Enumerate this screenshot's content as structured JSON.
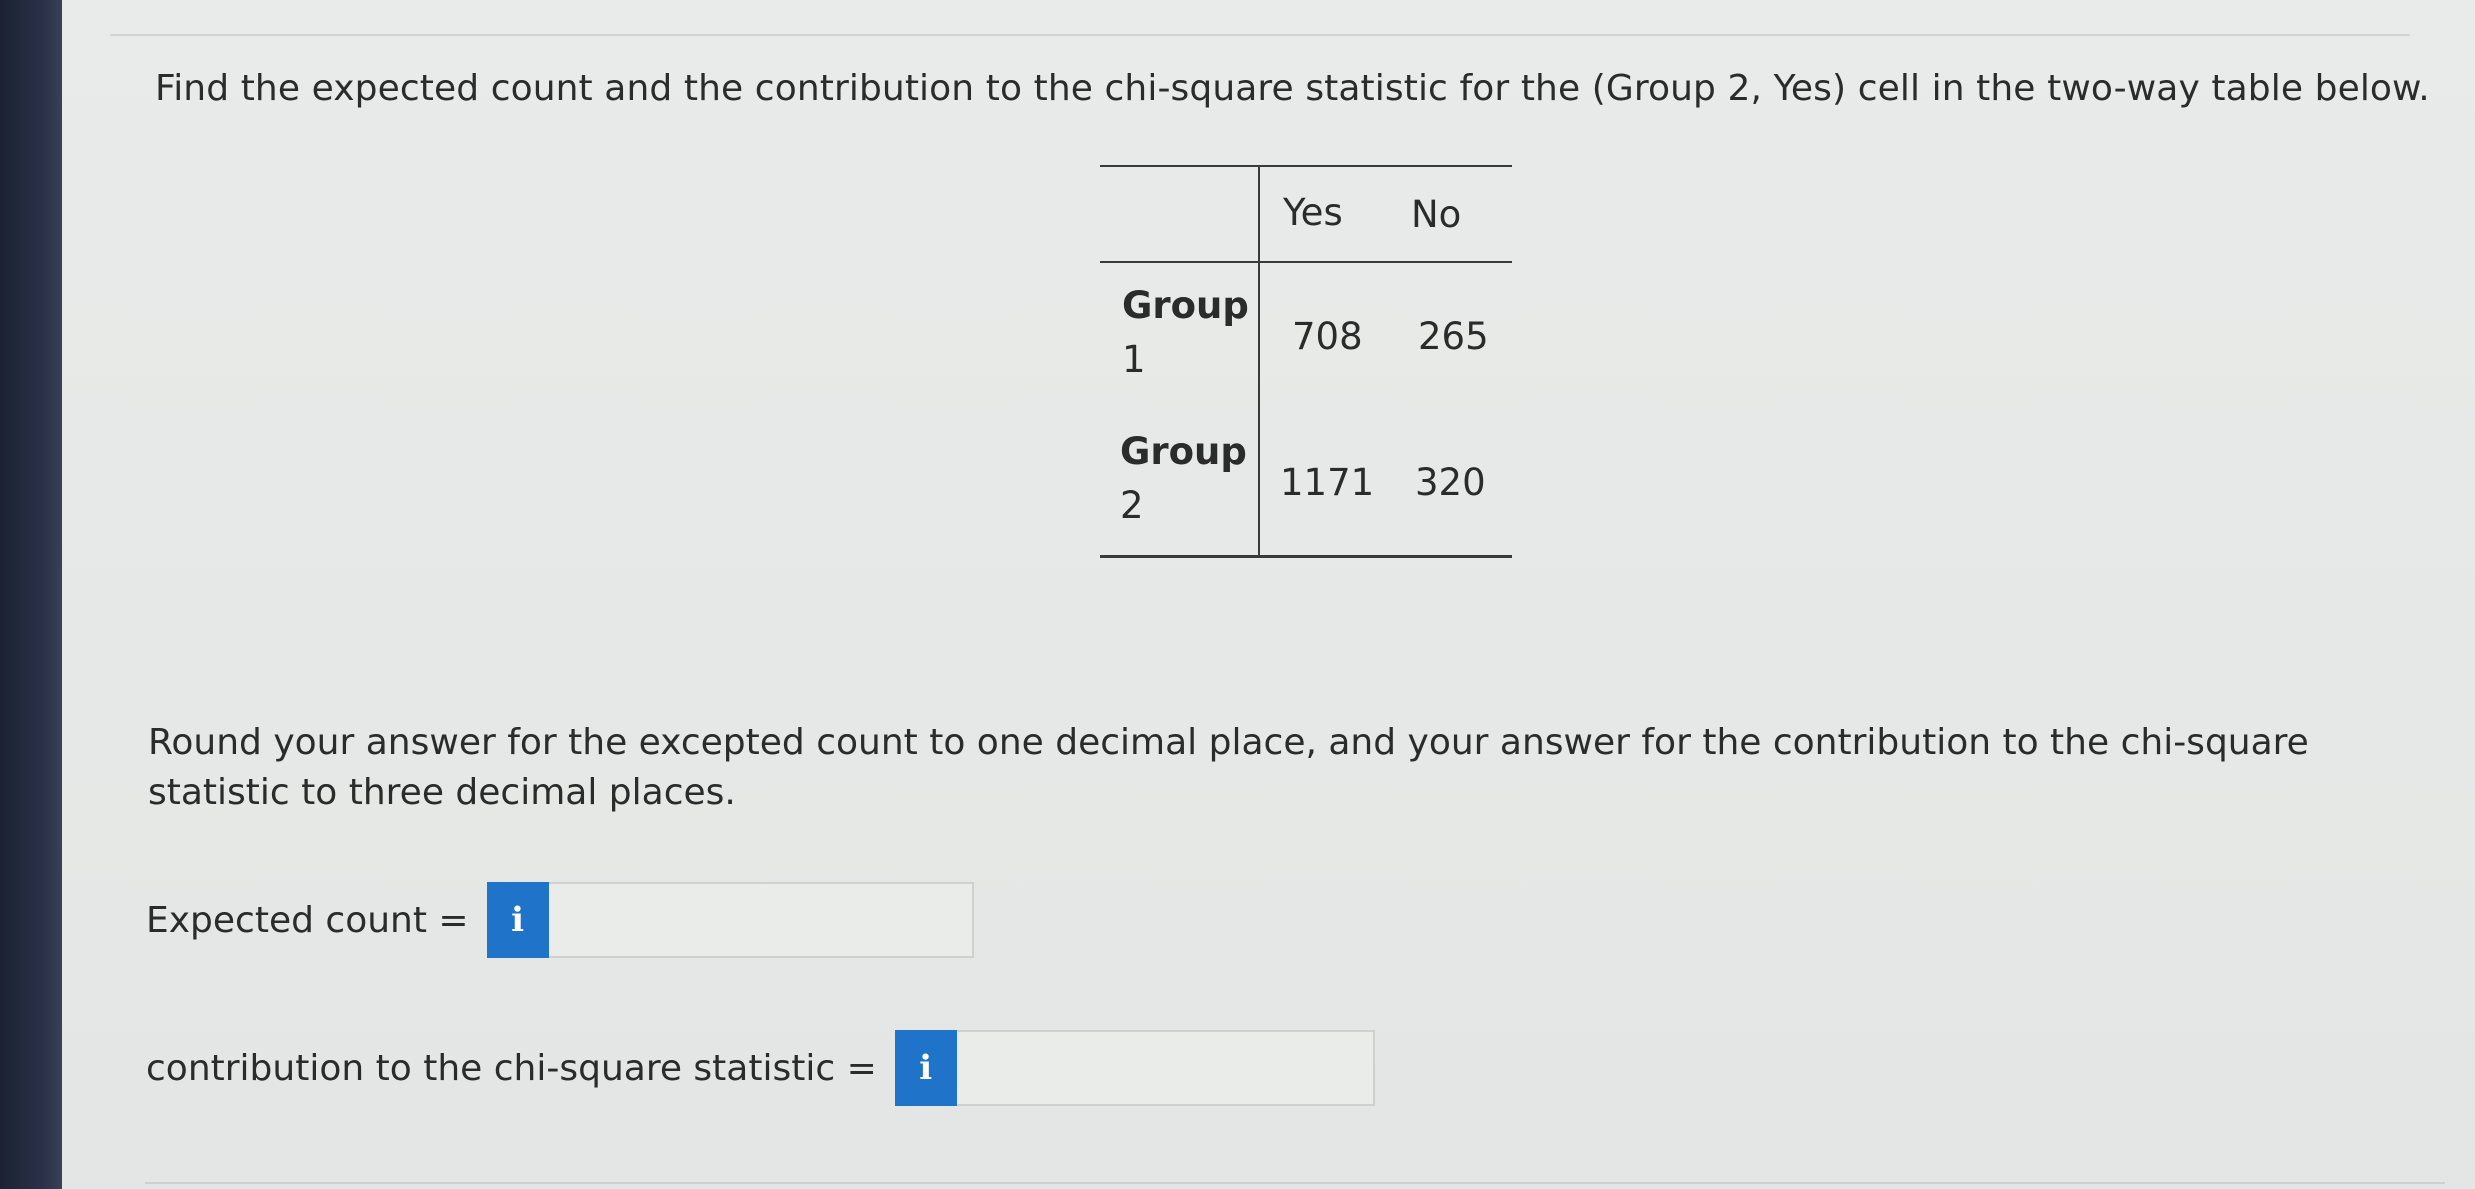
{
  "question": {
    "text": "Find the expected count and the contribution to the chi-square statistic for the (Group 2, Yes) cell in the two-way table below."
  },
  "table": {
    "columns": [
      "Yes",
      "No"
    ],
    "rows": [
      {
        "label_line1": "Group",
        "label_line2": "1",
        "yes": "708",
        "no": "265"
      },
      {
        "label_line1": "Group",
        "label_line2": "2",
        "yes": "1171",
        "no": "320"
      }
    ]
  },
  "instructions": {
    "text": "Round your answer for the excepted count to one decimal place, and your answer for the contribution to the chi-square statistic to three decimal places."
  },
  "answers": {
    "expected": {
      "label": "Expected count =",
      "info_icon_glyph": "i",
      "value": ""
    },
    "contribution": {
      "label": "contribution to the chi-square statistic =",
      "info_icon_glyph": "i",
      "value": ""
    }
  },
  "colors": {
    "info_button": "#1f73c9",
    "text": "#2b2b2b",
    "panel_background": "#e8eae9",
    "left_bar": "#1c2233"
  }
}
